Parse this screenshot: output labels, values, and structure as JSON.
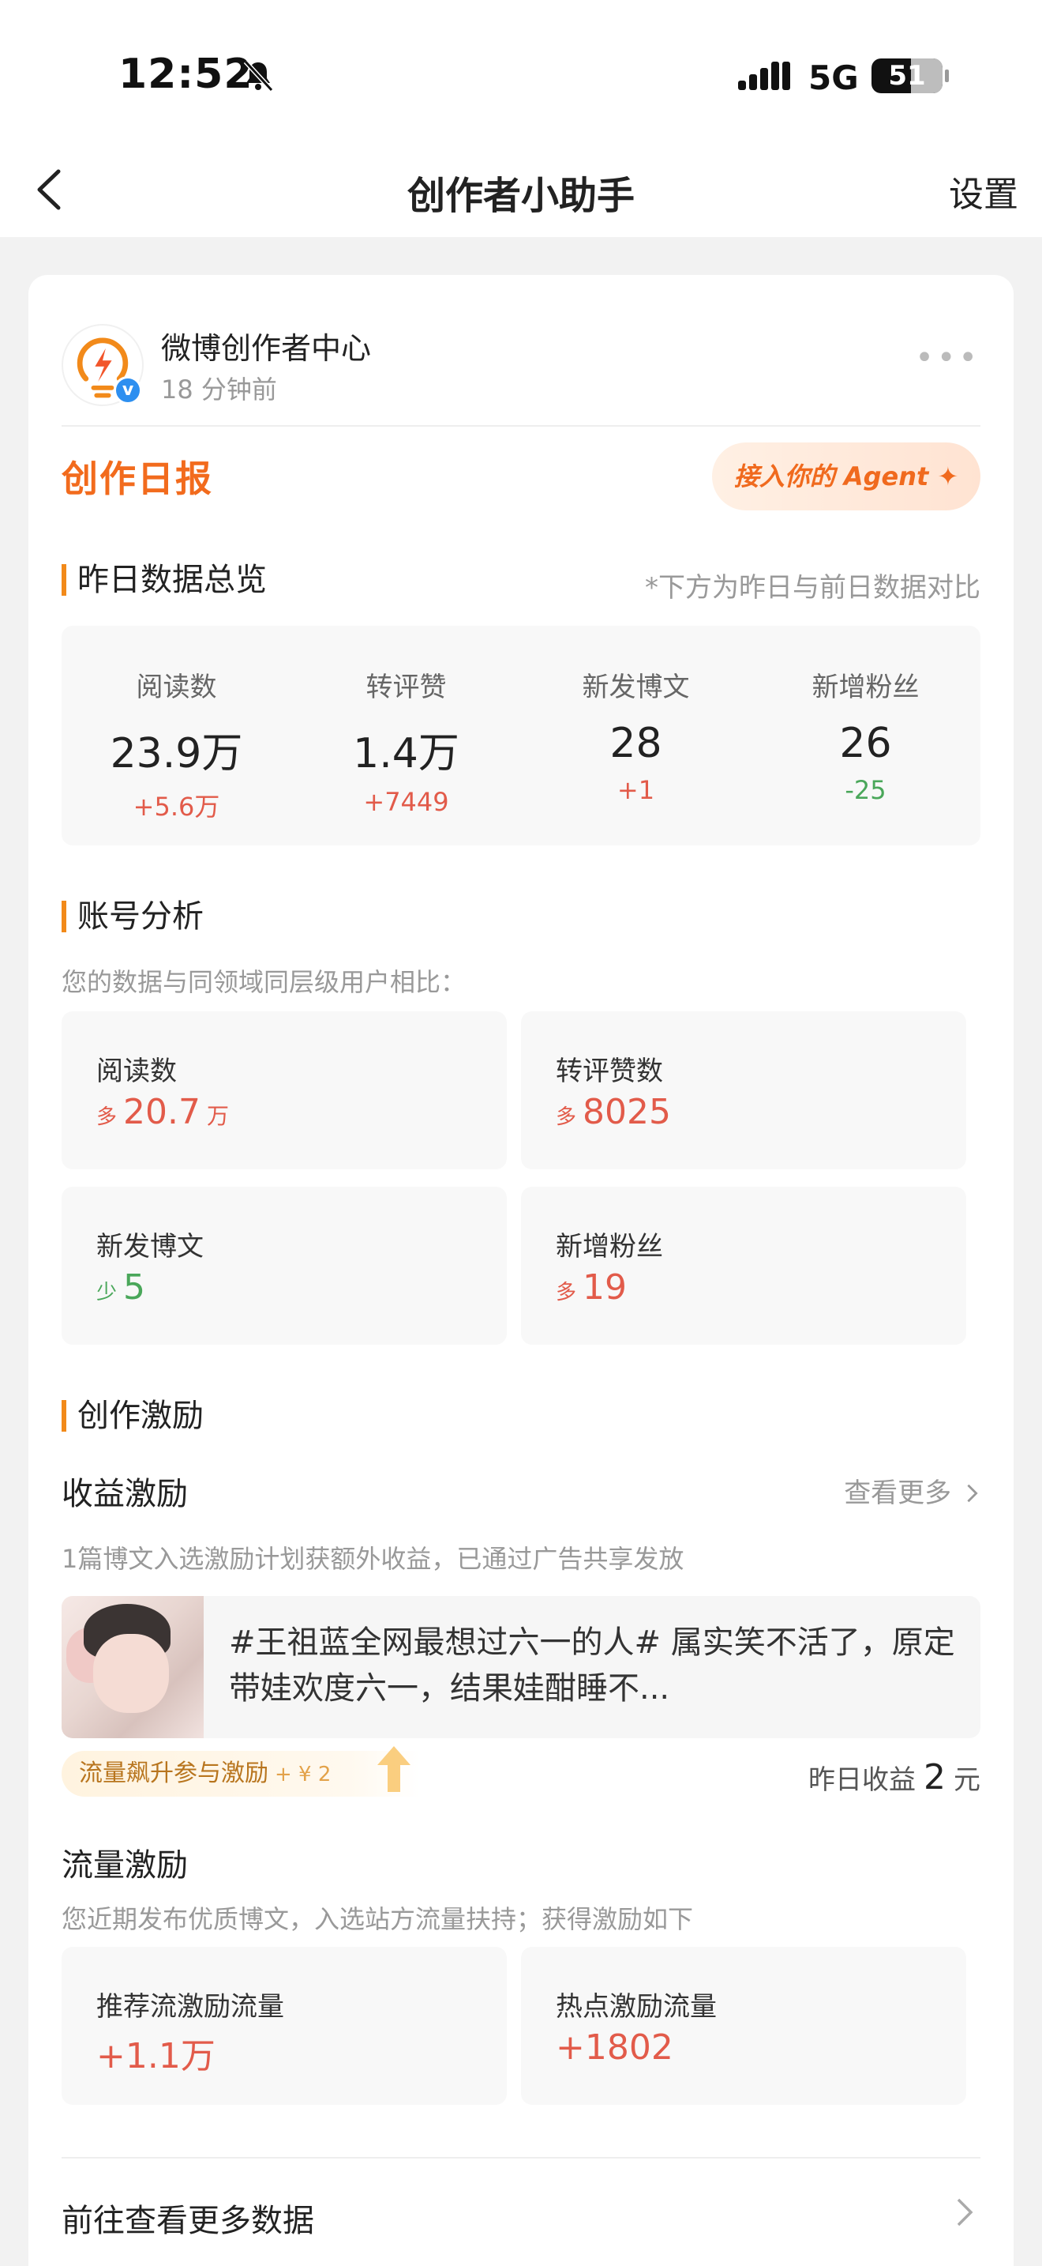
{
  "status_bar": {
    "time": "12:52",
    "network": "5G",
    "battery": "51"
  },
  "nav": {
    "title": "创作者小助手",
    "settings_label": "设置"
  },
  "source": {
    "name": "微博创作者中心",
    "time": "18 分钟前"
  },
  "daily": {
    "title": "创作日报",
    "agent_button": "接入你的 Agent ✦"
  },
  "overview": {
    "title": "昨日数据总览",
    "note": "*下方为昨日与前日数据对比",
    "items": [
      {
        "label": "阅读数",
        "value": "23.9万",
        "delta": "+5.6万"
      },
      {
        "label": "转评赞",
        "value": "1.4万",
        "delta": "+7449"
      },
      {
        "label": "新发博文",
        "value": "28",
        "delta": "+1"
      },
      {
        "label": "新增粉丝",
        "value": "26",
        "delta": "-25"
      }
    ]
  },
  "analysis": {
    "title": "账号分析",
    "subtitle": "您的数据与同领域同层级用户相比：",
    "items": [
      {
        "label": "阅读数",
        "prefix": "多",
        "value": "20.7",
        "unit": "万"
      },
      {
        "label": "转评赞数",
        "prefix": "多",
        "value": "8025",
        "unit": ""
      },
      {
        "label": "新发博文",
        "prefix": "少",
        "value": "5",
        "unit": ""
      },
      {
        "label": "新增粉丝",
        "prefix": "多",
        "value": "19",
        "unit": ""
      }
    ]
  },
  "incentive": {
    "title": "创作激励",
    "income": {
      "title": "收益激励",
      "more": "查看更多",
      "desc": "1篇博文入选激励计划获额外收益，已通过广告共享发放",
      "post_text": "#王祖蓝全网最想过六一的人# 属实笑不活了，原定带娃欢度六一，结果娃酣睡不...",
      "tag": "流量飙升参与激励",
      "tag_amount": "+ ¥ 2",
      "earn_label": "昨日收益",
      "earn_value": "2",
      "earn_unit": "元"
    },
    "traffic": {
      "title": "流量激励",
      "desc": "您近期发布优质博文，入选站方流量扶持；获得激励如下",
      "items": [
        {
          "label": "推荐流激励流量",
          "value": "+1.1万"
        },
        {
          "label": "热点激励流量",
          "value": "+1802"
        }
      ]
    }
  },
  "footer": {
    "link": "前往查看更多数据"
  },
  "colors": {
    "accent_orange": "#f26b1d",
    "up_red": "#e25b4a",
    "down_green": "#4aa75a"
  }
}
